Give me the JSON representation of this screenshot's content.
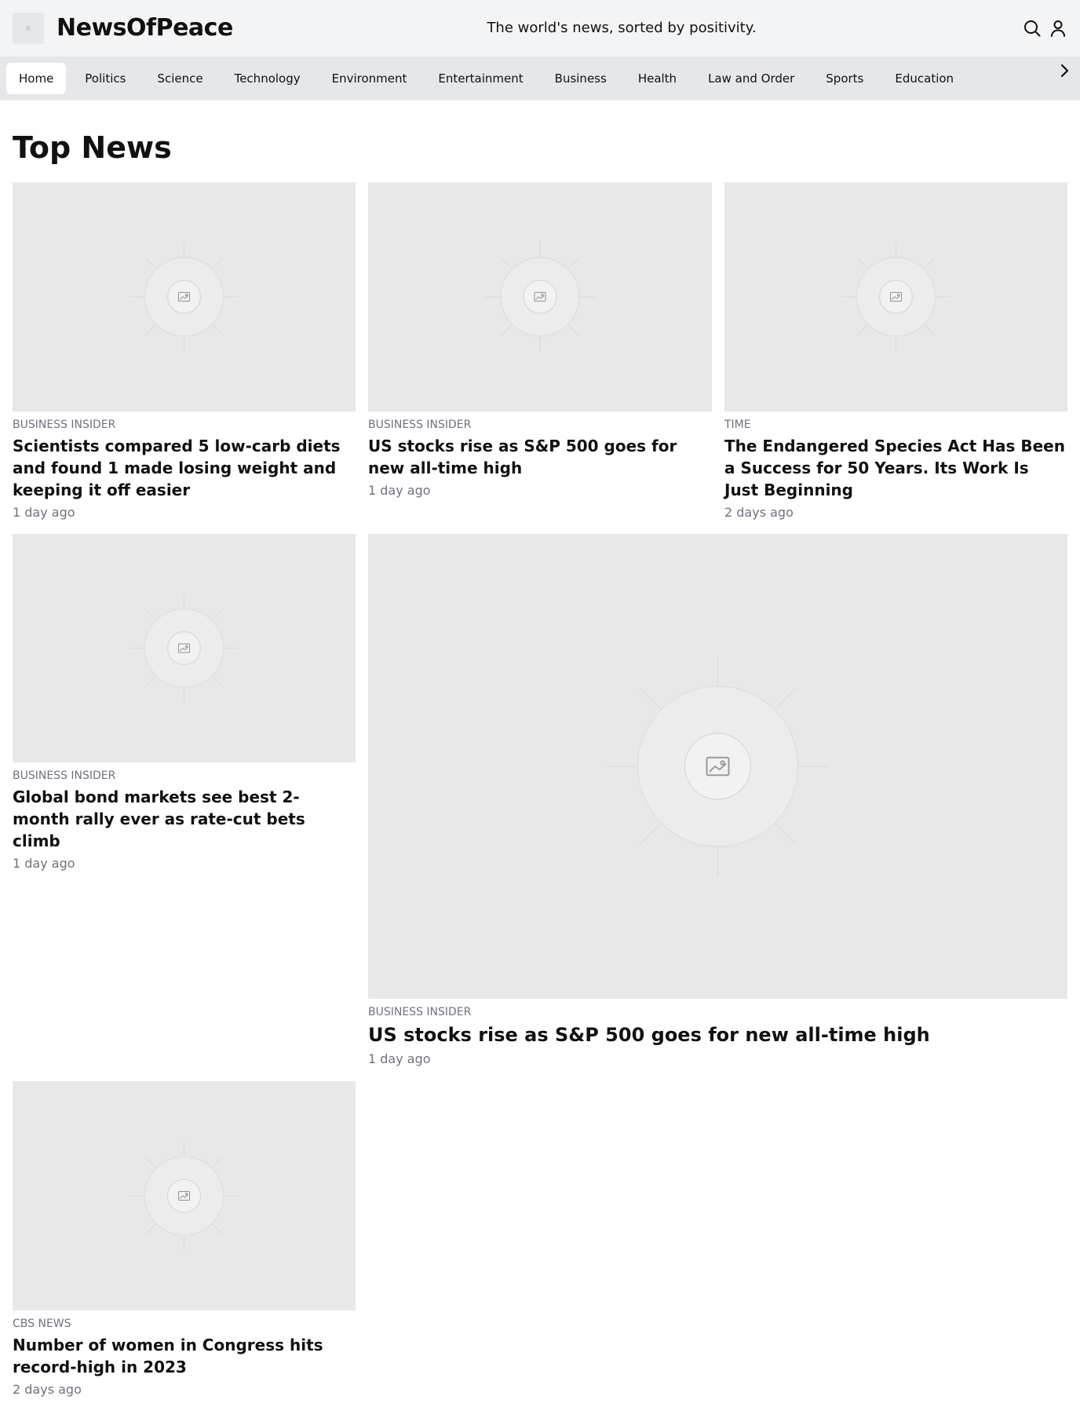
{
  "header": {
    "brand": "NewsOfPeace",
    "tagline": "The world's news, sorted by positivity.",
    "search_icon": "search-icon",
    "account_icon": "user-icon"
  },
  "nav": {
    "categories": [
      "Home",
      "Politics",
      "Science",
      "Technology",
      "Environment",
      "Entertainment",
      "Business",
      "Health",
      "Law and Order",
      "Sports",
      "Education"
    ],
    "active": "Home",
    "next_icon": "chevron-right-icon"
  },
  "main": {
    "section_title": "Top News",
    "articles": [
      {
        "source": "Business Insider",
        "title": "Scientists compared 5 low-carb diets and found 1 made losing weight and keeping it off easier",
        "age": "1 day ago",
        "image_icon": "image-placeholder-icon"
      },
      {
        "source": "Business Insider",
        "title": "US stocks rise as S&P 500 goes for new all-time high",
        "age": "1 day ago",
        "image_icon": "image-placeholder-icon"
      },
      {
        "source": "TIME",
        "title": "The Endangered Species Act Has Been a Success for 50 Years. Its Work Is Just Beginning",
        "age": "2 days ago",
        "image_icon": "image-placeholder-icon"
      },
      {
        "source": "Business Insider",
        "title": "Global bond markets see best 2-month rally ever as rate-cut bets climb",
        "age": "1 day ago",
        "image_icon": "image-placeholder-icon"
      },
      {
        "source": "Business Insider",
        "title": "US stocks rise as S&P 500 goes for new all-time high",
        "age": "1 day ago",
        "image_icon": "image-placeholder-icon"
      },
      {
        "source": "CBS News",
        "title": "Number of women in Congress hits record-high in 2023",
        "age": "2 days ago",
        "image_icon": "image-placeholder-icon"
      }
    ]
  },
  "colors": {
    "header_bg": "#f3f4f6",
    "nav_bg": "#e5e7eb",
    "placeholder_bg": "#e8e8e8",
    "muted_text": "#6b7280"
  }
}
